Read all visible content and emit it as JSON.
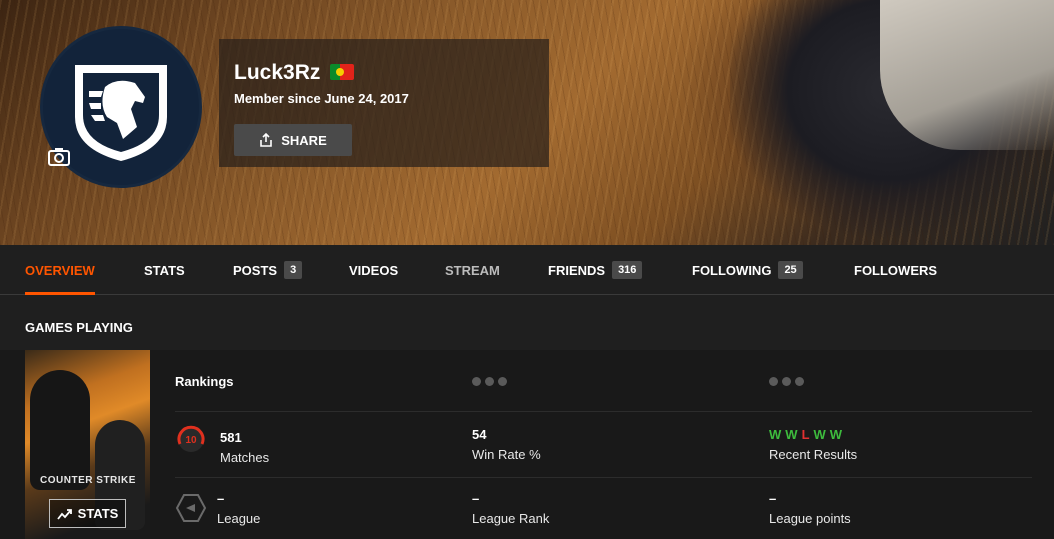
{
  "profile": {
    "username": "Luck3Rz",
    "member_since": "Member since June 24, 2017",
    "share_label": "SHARE",
    "country_flag": "portugal-flag"
  },
  "tabs": [
    {
      "label": "OVERVIEW",
      "active": true
    },
    {
      "label": "STATS"
    },
    {
      "label": "POSTS",
      "badge": "3"
    },
    {
      "label": "VIDEOS"
    },
    {
      "label": "STREAM"
    },
    {
      "label": "FRIENDS",
      "badge": "316"
    },
    {
      "label": "FOLLOWING",
      "badge": "25"
    },
    {
      "label": "FOLLOWERS"
    }
  ],
  "games_section": {
    "title": "GAMES PLAYING",
    "game": {
      "logo_text": "COUNTER STRIKE",
      "stats_label": "STATS",
      "rankings_label": "Rankings",
      "skill_level": "10",
      "matches": {
        "value": "581",
        "label": "Matches"
      },
      "win_rate": {
        "value": "54",
        "label": "Win Rate %"
      },
      "recent": {
        "label": "Recent Results",
        "results": [
          "W",
          "W",
          "L",
          "W",
          "W"
        ]
      },
      "league": {
        "value": "–",
        "label": "League"
      },
      "league_rank": {
        "value": "–",
        "label": "League Rank"
      },
      "league_points": {
        "value": "–",
        "label": "League points"
      }
    }
  },
  "colors": {
    "accent": "#ff5500",
    "win": "#3dbb3d",
    "loss": "#e03030",
    "background": "#1f1f1f"
  }
}
